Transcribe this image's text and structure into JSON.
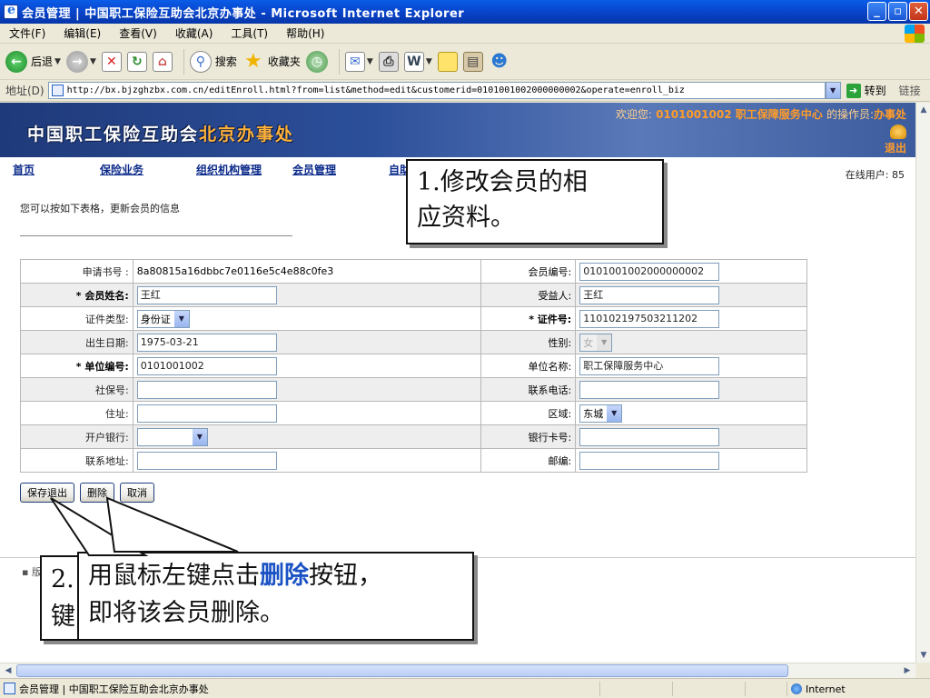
{
  "window": {
    "title": "会员管理 | 中国职工保险互助会北京办事处 - Microsoft Internet Explorer",
    "minimize": "_",
    "maximize": "▫",
    "close": "✕"
  },
  "menu": {
    "items": [
      "文件(F)",
      "编辑(E)",
      "查看(V)",
      "收藏(A)",
      "工具(T)",
      "帮助(H)"
    ]
  },
  "toolbar": {
    "back_label": "后退",
    "search_label": "搜索",
    "favorites_label": "收藏夹"
  },
  "address": {
    "label": "地址(D)",
    "url": "http://bx.bjzghzbx.com.cn/editEnroll.html?from=list&method=edit&customerid=0101001002000000002&operate=enroll_biz",
    "go_label": "转到",
    "links_label": "链接"
  },
  "banner": {
    "logo_white": "中国职工保险互助会",
    "logo_orange": "北京办事处",
    "welcome_prefix": "欢迎您:",
    "welcome_user": "0101001002 职工保障服务中心",
    "operator_label": "的操作员:",
    "operator_name": "办事处",
    "logout": "退出"
  },
  "nav": {
    "items": [
      "首页",
      "保险业务",
      "组织机构管理",
      "会员管理",
      "自助"
    ],
    "online_users": "在线用户: 85"
  },
  "page": {
    "hint": "您可以按如下表格，更新会员的信息"
  },
  "form": {
    "application_no_label": "申请书号 :",
    "application_no": "8a80815a16dbbc7e0116e5c4e88c0fe3",
    "member_no_label": "会员编号:",
    "member_no": "0101001002000000002",
    "member_name_label": "* 会员姓名:",
    "member_name": "王红",
    "beneficiary_label": "受益人:",
    "beneficiary": "王红",
    "id_type_label": "证件类型:",
    "id_type": "身份证",
    "id_no_label": "* 证件号:",
    "id_no": "110102197503211202",
    "birth_label": "出生日期:",
    "birth": "1975-03-21",
    "gender_label": "性别:",
    "gender": "女",
    "unit_no_label": "* 单位编号:",
    "unit_no": "0101001002",
    "unit_name_label": "单位名称:",
    "unit_name": "职工保障服务中心",
    "social_label": "社保号:",
    "social": "",
    "phone_label": "联系电话:",
    "phone": "",
    "address_label": "住址:",
    "address": "",
    "district_label": "区域:",
    "district": "东城",
    "bank_label": "开户银行:",
    "bank": "",
    "card_label": "银行卡号:",
    "card": "",
    "contact_label": "联系地址:",
    "contact": "",
    "postcode_label": "邮编:",
    "postcode": ""
  },
  "buttons": {
    "save": "保存退出",
    "delete": "删除",
    "cancel": "取消"
  },
  "footer": {
    "bullet": "▪ 版"
  },
  "callouts": {
    "c1_line1": "1.修改会员的相",
    "c1_line2": "应资料。",
    "c2_line1": "2.",
    "c2_line2": "键",
    "c3_prefix": "用鼠标左键点击",
    "c3_highlight": "删除",
    "c3_suffix": "按钮，",
    "c3_line2": "即将该会员删除。"
  },
  "status": {
    "text": "会员管理 | 中国职工保险互助会北京办事处",
    "zone": "Internet"
  },
  "colors": {
    "titlebar": "#0842c8",
    "nav_link": "#0b2a8a",
    "banner_orange": "#ff9c2a",
    "highlight_blue": "#1a52c4"
  }
}
